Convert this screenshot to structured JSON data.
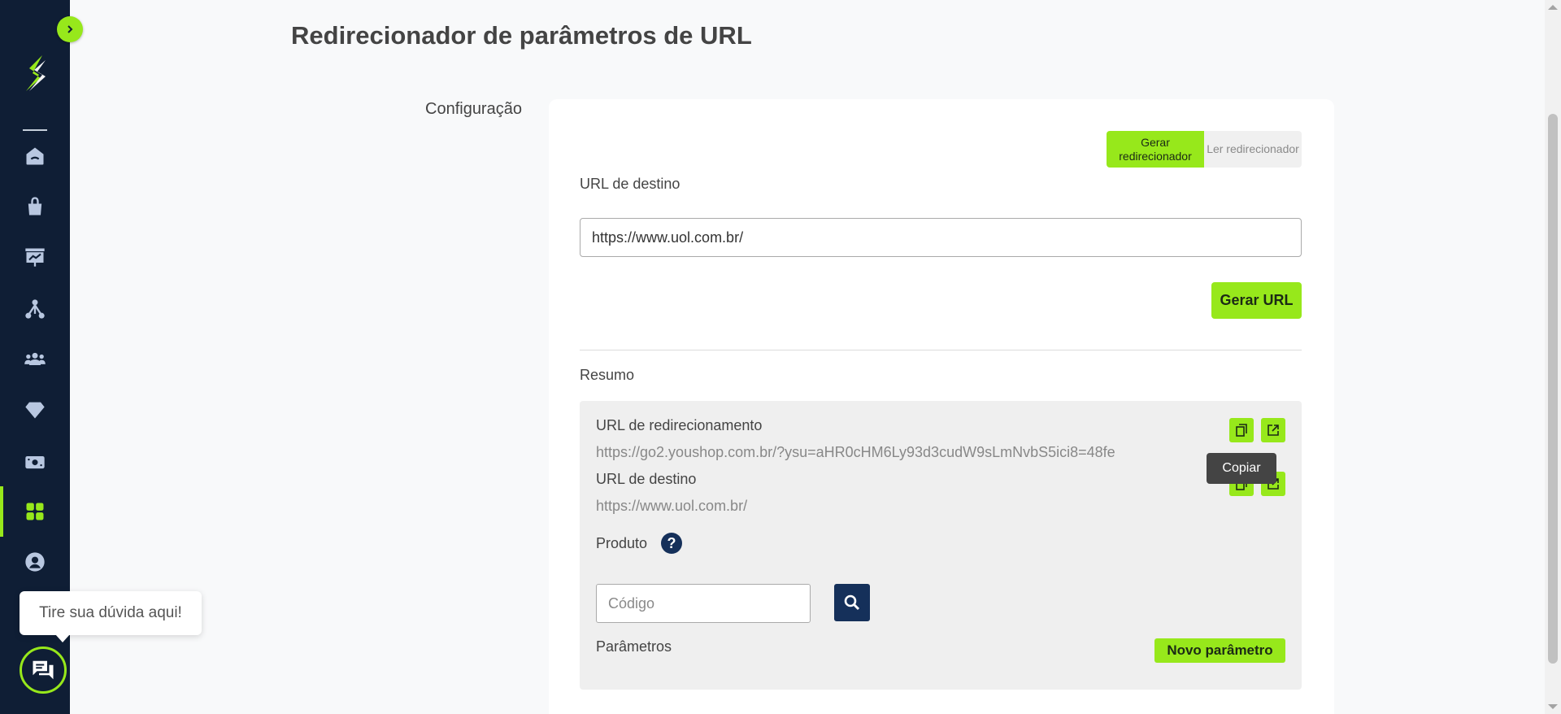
{
  "page": {
    "title": "Redirecionador de parâmetros de URL"
  },
  "sidebar": {
    "items": [
      {
        "icon": "home-icon"
      },
      {
        "icon": "shopping-bag-icon"
      },
      {
        "icon": "presentation-chart-icon"
      },
      {
        "icon": "network-icon"
      },
      {
        "icon": "users-icon"
      },
      {
        "icon": "diamond-icon"
      },
      {
        "icon": "money-icon"
      },
      {
        "icon": "apps-grid-icon",
        "active": true
      },
      {
        "icon": "user-circle-icon"
      }
    ]
  },
  "chat": {
    "tooltip": "Tire sua dúvida aqui!"
  },
  "config": {
    "section_label": "Configuração",
    "mode_tabs": [
      "Gerar redirecionador",
      "Ler redirecionador"
    ],
    "destination_label": "URL de destino",
    "destination_value": "https://www.uol.com.br/",
    "generate_button": "Gerar URL"
  },
  "summary": {
    "title": "Resumo",
    "redirect_label": "URL de redirecionamento",
    "redirect_value": "https://go2.youshop.com.br/?ysu=aHR0cHM6Ly93d3cudW9sLmNvbS5ici8=48fe",
    "destination_label": "URL de destino",
    "destination_value": "https://www.uol.com.br/",
    "copy_tooltip": "Copiar",
    "product_label": "Produto",
    "code_placeholder": "Código",
    "params_label": "Parâmetros",
    "new_param_button": "Novo parâmetro"
  },
  "colors": {
    "accent": "#97e81b",
    "sidebar": "#0f1e35",
    "navy": "#15305a"
  }
}
